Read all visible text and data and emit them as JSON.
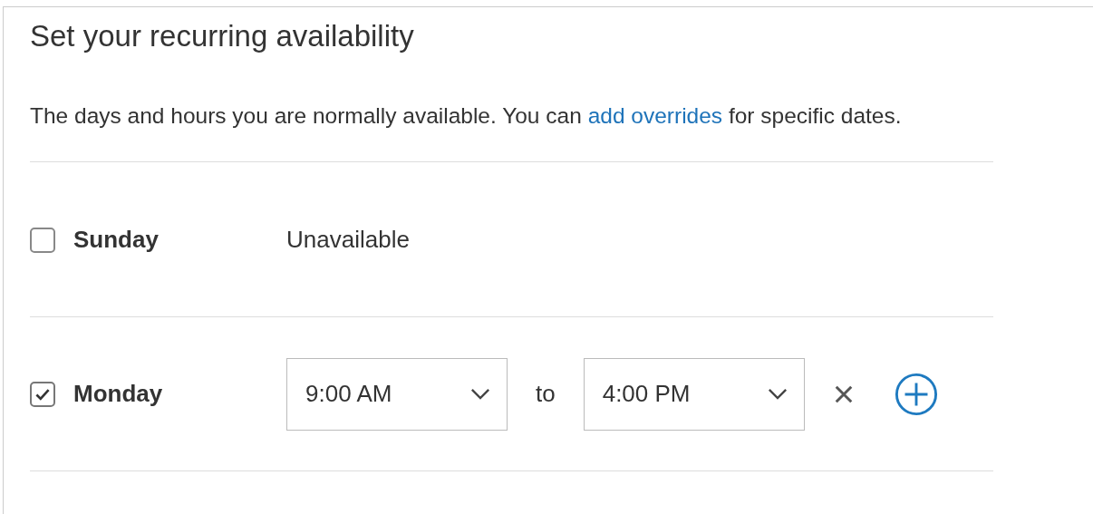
{
  "title": "Set your recurring availability",
  "description": {
    "before": "The days and hours you are normally available. You can ",
    "link": "add overrides",
    "after": " for specific dates."
  },
  "days": [
    {
      "name": "Sunday",
      "checked": false,
      "status": "Unavailable"
    },
    {
      "name": "Monday",
      "checked": true,
      "intervals": [
        {
          "start": "9:00 AM",
          "separator": "to",
          "end": "4:00 PM"
        }
      ]
    }
  ]
}
